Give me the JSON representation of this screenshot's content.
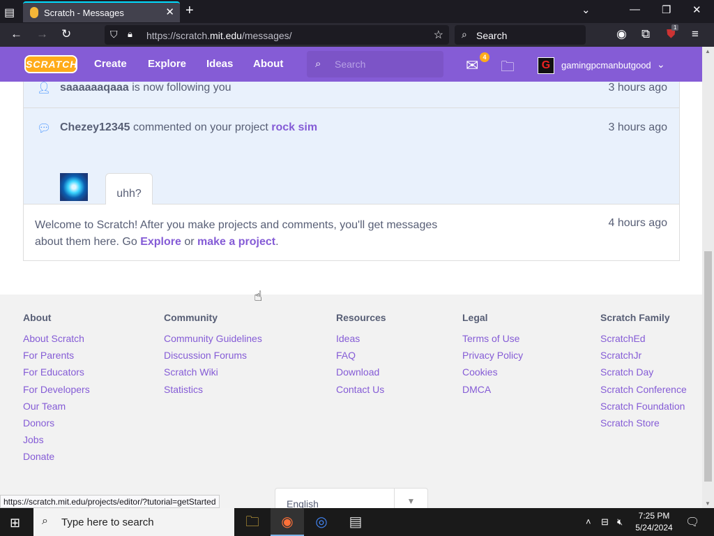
{
  "browser": {
    "tab_title": "Scratch - Messages",
    "url_prefix": "https://scratch.",
    "url_domain": "mit.edu",
    "url_suffix": "/messages/",
    "search_placeholder": "Search",
    "ext_badge": "1"
  },
  "header": {
    "logo": "SCRATCH",
    "nav": [
      "Create",
      "Explore",
      "Ideas",
      "About"
    ],
    "search_placeholder": "Search",
    "mail_count": "4",
    "username": "gamingpcmanbutgood",
    "avatar_letter": "G"
  },
  "messages": {
    "follow": {
      "user": "saaaaaaqaaa",
      "text": " is now following you",
      "time": "3 hours ago"
    },
    "comment": {
      "user": "Chezey12345",
      "text": " commented on your project ",
      "project": "rock sim",
      "time": "3 hours ago",
      "body": "uhh?"
    },
    "welcome": {
      "line1": "Welcome to Scratch! After you make projects and comments, you'll get messages",
      "line2_a": "about them here. Go ",
      "link1": "Explore",
      "or": " or ",
      "link2": "make a project",
      "period": ".",
      "time": "4 hours ago"
    }
  },
  "footer": {
    "columns": [
      {
        "title": "About",
        "links": [
          "About Scratch",
          "For Parents",
          "For Educators",
          "For Developers",
          "Our Team",
          "Donors",
          "Jobs",
          "Donate"
        ]
      },
      {
        "title": "Community",
        "links": [
          "Community Guidelines",
          "Discussion Forums",
          "Scratch Wiki",
          "Statistics"
        ]
      },
      {
        "title": "Resources",
        "links": [
          "Ideas",
          "FAQ",
          "Download",
          "Contact Us"
        ]
      },
      {
        "title": "Legal",
        "links": [
          "Terms of Use",
          "Privacy Policy",
          "Cookies",
          "DMCA"
        ]
      },
      {
        "title": "Scratch Family",
        "links": [
          "ScratchEd",
          "ScratchJr",
          "Scratch Day",
          "Scratch Conference",
          "Scratch Foundation",
          "Scratch Store"
        ]
      }
    ],
    "language": "English"
  },
  "status_url": "https://scratch.mit.edu/projects/editor/?tutorial=getStarted",
  "taskbar": {
    "search_placeholder": "Type here to search",
    "time": "7:25 PM",
    "date": "5/24/2024"
  }
}
